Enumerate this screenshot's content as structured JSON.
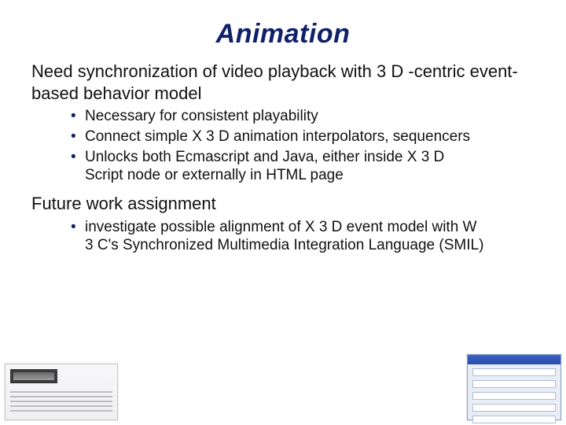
{
  "title": "Animation",
  "section1": {
    "text": "Need synchronization of video playback with 3 D -centric event-based behavior model",
    "bullets": [
      "Necessary for consistent playability",
      "Connect simple X 3 D animation interpolators, sequencers",
      "Unlocks both Ecmascript and Java, either inside X 3 D Script node or externally in HTML page"
    ]
  },
  "section2": {
    "text": "Future work assignment",
    "bullets": [
      "investigate possible alignment of X 3 D event model with W 3 C's Synchronized Multimedia Integration Language (SMIL)"
    ]
  }
}
